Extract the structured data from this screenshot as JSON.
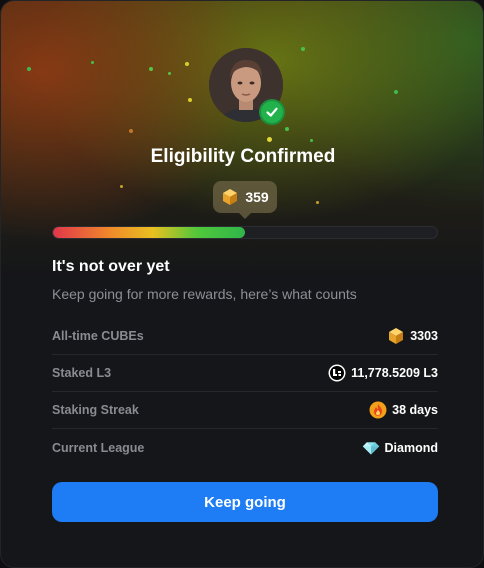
{
  "header": {
    "title": "Eligibility Confirmed",
    "status_icon": "check-icon"
  },
  "cubes_badge": {
    "icon": "cube-icon",
    "value": "359"
  },
  "progress": {
    "fraction": 0.5
  },
  "section": {
    "heading": "It's not over yet",
    "description": "Keep going for more rewards, here’s what counts"
  },
  "stats": [
    {
      "label": "All-time CUBEs",
      "value": "3303",
      "icon": "cube-icon"
    },
    {
      "label": "Staked L3",
      "value": "11,778.5209 L3",
      "icon": "l3-logo-icon"
    },
    {
      "label": "Staking Streak",
      "value": "38 days",
      "icon": "flame-icon"
    },
    {
      "label": "Current League",
      "value": "Diamond",
      "icon": "diamond-icon"
    }
  ],
  "cta": {
    "label": "Keep going"
  },
  "colors": {
    "accent": "#1e7cf5",
    "success": "#22b24c",
    "card_bg": "#151619"
  }
}
